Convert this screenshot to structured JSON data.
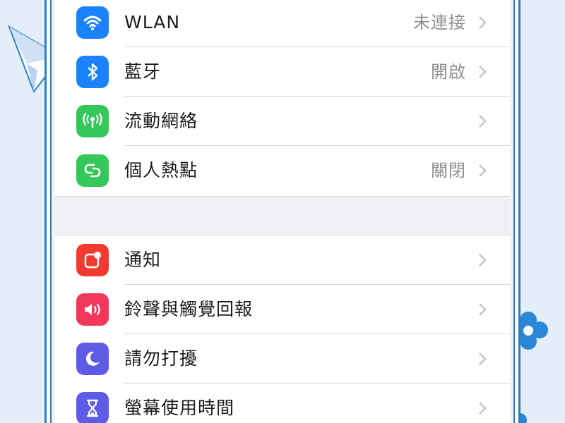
{
  "settings": {
    "group1": [
      {
        "label": "WLAN",
        "value": "未連接",
        "icon": "wifi-icon",
        "icon_color": "#1a82fb"
      },
      {
        "label": "藍牙",
        "value": "開啟",
        "icon": "bluetooth-icon",
        "icon_color": "#1a82fb"
      },
      {
        "label": "流動網絡",
        "value": "",
        "icon": "cellular-antenna-icon",
        "icon_color": "#34c759"
      },
      {
        "label": "個人熱點",
        "value": "關閉",
        "icon": "personal-hotspot-icon",
        "icon_color": "#34c759"
      }
    ],
    "group2": [
      {
        "label": "通知",
        "value": "",
        "icon": "notifications-icon",
        "icon_color": "#f23b30"
      },
      {
        "label": "鈴聲與觸覺回報",
        "value": "",
        "icon": "speaker-icon",
        "icon_color": "#f2385a"
      },
      {
        "label": "請勿打擾",
        "value": "",
        "icon": "moon-icon",
        "icon_color": "#5e5ce6"
      },
      {
        "label": "螢幕使用時間",
        "value": "",
        "icon": "hourglass-icon",
        "icon_color": "#5e5ce6"
      }
    ]
  },
  "colors": {
    "background": "#e3eef9",
    "frame": "#2a7fc4",
    "chevron": "#c4c4c7"
  }
}
